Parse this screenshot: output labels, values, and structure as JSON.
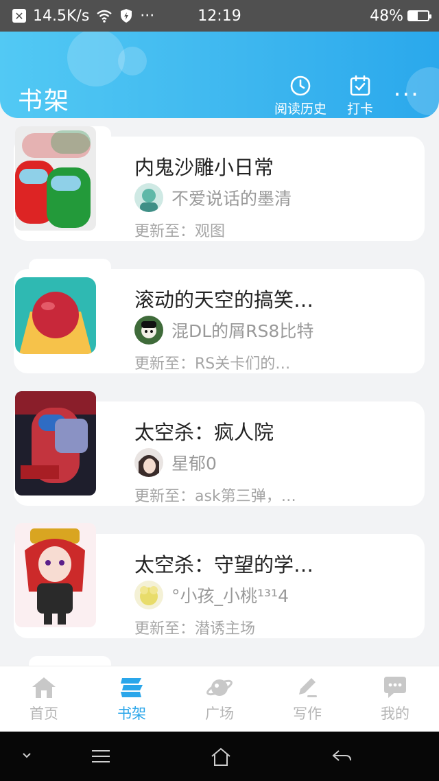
{
  "status_bar": {
    "net_speed": "14.5K/s",
    "dots": "···",
    "time": "12:19",
    "battery": "48%",
    "battery_level": 0.48
  },
  "header": {
    "title": "书架",
    "history_label": "阅读历史",
    "checkin_label": "打卡",
    "more": "···",
    "colors": {
      "start": "#52c9f4",
      "end": "#2aa8ec"
    }
  },
  "books": [
    {
      "title": "内鬼沙雕小日常",
      "author": "不爱说话的墨清",
      "update_prefix": "更新至：",
      "update": "观图"
    },
    {
      "title": "滚动的天空的搞笑…",
      "author": "混DL的屑RS8比特",
      "update_prefix": "更新至：",
      "update": "RS关卡们的…"
    },
    {
      "title": "太空杀：疯人院",
      "author": "星郁0",
      "update_prefix": "更新至：",
      "update": "ask第三弹，…"
    },
    {
      "title": "太空杀：守望的学…",
      "author": "°小孩_小桃¹³¹4",
      "update_prefix": "更新至：",
      "update": "潜诱主场"
    }
  ],
  "tabs": [
    {
      "label": "首页",
      "icon": "home-icon"
    },
    {
      "label": "书架",
      "icon": "bookshelf-icon",
      "active": true
    },
    {
      "label": "广场",
      "icon": "planet-icon"
    },
    {
      "label": "写作",
      "icon": "pen-icon"
    },
    {
      "label": "我的",
      "icon": "chat-bubble-icon"
    }
  ],
  "accent_color": "#2aa6ea"
}
